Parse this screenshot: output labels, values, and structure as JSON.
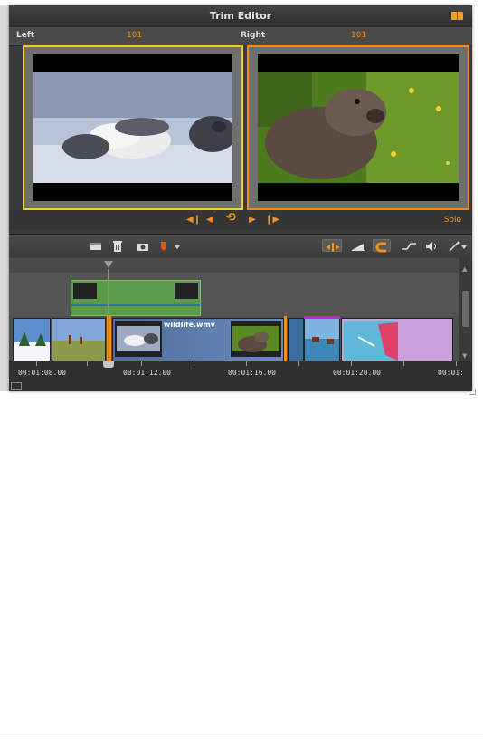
{
  "window": {
    "title": "Trim Editor",
    "maximize_icon": "maximize-icon"
  },
  "left": {
    "label": "Left",
    "frame": "101"
  },
  "right": {
    "label": "Right",
    "frame": "101"
  },
  "transport": {
    "buttons": [
      "go-to-start-icon",
      "step-back-icon",
      "loop-icon",
      "step-forward-icon",
      "go-to-end-icon"
    ],
    "solo_label": "Solo"
  },
  "toolbar": {
    "left_icons": [
      "title-icon",
      "trash-icon",
      "snapshot-icon",
      "marker-icon",
      "dropdown-icon"
    ],
    "right_icons": [
      "trim-mode-icon",
      "ripple-icon",
      "magnet-icon",
      "audio-curve-icon",
      "speaker-icon",
      "magic-wand-icon"
    ]
  },
  "timeline": {
    "clip_name": "wildlife.wmv",
    "timecodes": [
      "00:01:08.00",
      "00:01:12.00",
      "00:01:16.00",
      "00:01:20.00",
      "00:01:"
    ]
  },
  "colors": {
    "left_accent": "#f6cf1e",
    "right_accent": "#f08c1e",
    "orange": "#f0901e"
  }
}
